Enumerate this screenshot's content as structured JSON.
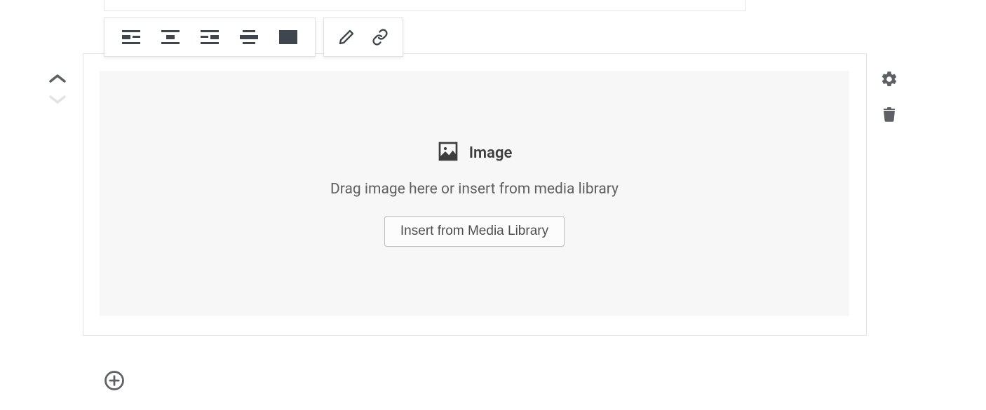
{
  "toolbar": {
    "align": {
      "left": "align-left",
      "center": "align-center",
      "right": "align-right",
      "wide": "align-wide",
      "full": "align-full"
    },
    "edit": "edit",
    "link": "link"
  },
  "move": {
    "up": "move-up",
    "down": "move-down"
  },
  "block": {
    "title": "Image",
    "description": "Drag image here or insert from media library",
    "insert_button": "Insert from Media Library"
  },
  "side": {
    "settings": "settings",
    "remove": "remove"
  },
  "add": {
    "label": "add-block"
  }
}
